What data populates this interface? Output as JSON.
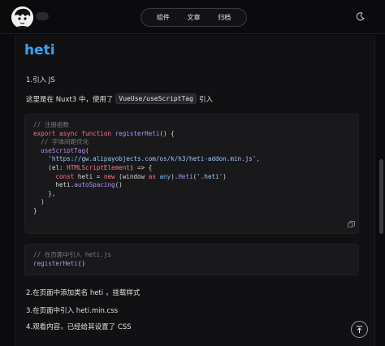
{
  "header": {
    "nav": [
      "组件",
      "文章",
      "归档"
    ]
  },
  "article": {
    "title": "heti",
    "steps": {
      "s1": "1.引入 JS",
      "s2": "2.在页面中添加类名 heti ，挂载样式",
      "s3": "3.在页面中引入 heti.min.css",
      "s4": "4.观看内容，已经给其设置了 CSS"
    },
    "para": {
      "before": "这里是在 Nuxt3 中，使用了",
      "code": "VueUse/useScriptTag",
      "after": "引入"
    },
    "code1": {
      "l1": "// 注册函数",
      "l2_kw": "export async function",
      "l2_fn": "registerHeti",
      "l2_rest": "() {",
      "l3": "// 字体间距优化",
      "l4_fn": "useScriptTag",
      "l4_rest": "(",
      "l5": "'https://gw.alipayobjects.com/os/k/h3/heti-addon.min.js',",
      "l6_a": "(el: ",
      "l6_t": "HTMLScriptElement",
      "l6_b": ") => {",
      "l7_kw": "const",
      "l7_a": " heti = ",
      "l7_new": "new",
      "l7_b": " (window ",
      "l7_as": "as",
      "l7_any": " any",
      "l7_c": ").",
      "l7_fn": "Heti",
      "l7_d": "(",
      "l7_str": "'.heti'",
      "l7_e": ")",
      "l8_a": "heti.",
      "l8_fn": "autoSpacing",
      "l8_b": "()",
      "l9": "},",
      "l10": ")",
      "l11": "}"
    },
    "code2": {
      "l1": "// 在页面中引入 heti.js",
      "l2_fn": "registerHeti",
      "l2_rest": "()"
    }
  },
  "icons": {
    "theme": "moon-icon",
    "copy": "copy-icon",
    "scroll_top": "arrow-up-icon",
    "avatar": "avatar-cartoon"
  }
}
